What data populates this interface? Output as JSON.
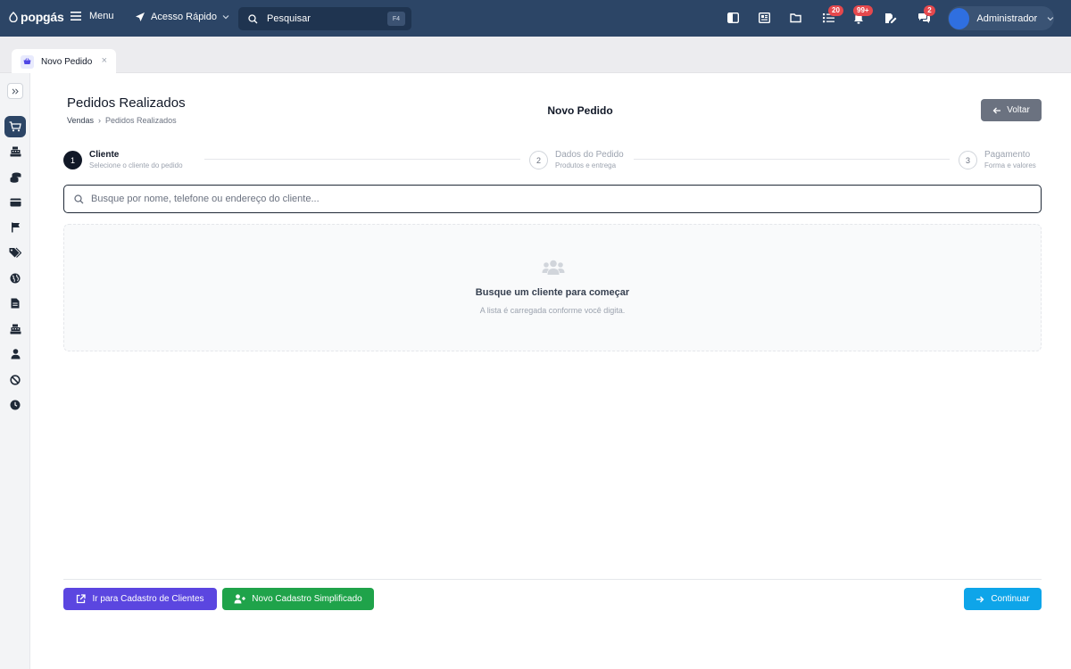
{
  "topbar": {
    "logo_text": "popgás",
    "menu_label": "Menu",
    "quick_access_label": "Acesso Rápido",
    "search_placeholder": "Pesquisar",
    "search_shortcut": "F4",
    "badges": {
      "tasks": "20",
      "notifications": "99+",
      "messages": "2"
    },
    "user_name": "Administrador"
  },
  "tabs": [
    {
      "label": "Novo Pedido",
      "close": "×"
    }
  ],
  "sidebar": {
    "items": [
      "cart-icon",
      "cash-register-icon",
      "coins-icon",
      "card-icon",
      "flag-icon",
      "tags-icon",
      "globe-icon",
      "file-icon",
      "cash-register-icon",
      "user-icon",
      "ban-icon",
      "clock-icon"
    ]
  },
  "page": {
    "title": "Pedidos Realizados",
    "breadcrumb": [
      "Vendas",
      "Pedidos Realizados"
    ],
    "breadcrumb_sep": "›",
    "center_title": "Novo Pedido",
    "back_label": "Voltar"
  },
  "stepper": {
    "steps": [
      {
        "number": "1",
        "title": "Cliente",
        "subtitle": "Selecione o cliente do pedido"
      },
      {
        "number": "2",
        "title": "Dados do Pedido",
        "subtitle": "Produtos e entrega"
      },
      {
        "number": "3",
        "title": "Pagamento",
        "subtitle": "Forma e valores"
      }
    ]
  },
  "client_search": {
    "placeholder": "Busque por nome, telefone ou endereço do cliente...",
    "value": ""
  },
  "empty_state": {
    "title": "Busque um cliente para começar",
    "subtitle": "A lista é carregada conforme você digita."
  },
  "footer": {
    "client_register_label": "Ir para Cadastro de Clientes",
    "simple_register_label": "Novo Cadastro Simplificado",
    "continue_label": "Continuar"
  },
  "colors": {
    "topbar": "#2c4566",
    "purple": "#5b46e0",
    "green": "#1fa34a",
    "cyan": "#0ea5e9"
  }
}
